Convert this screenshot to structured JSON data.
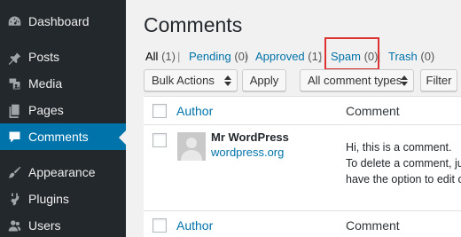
{
  "sidebar": {
    "items": [
      {
        "label": "Dashboard",
        "icon": "dashboard-icon"
      },
      {
        "label": "Posts",
        "icon": "pin-icon"
      },
      {
        "label": "Media",
        "icon": "media-icon"
      },
      {
        "label": "Pages",
        "icon": "pages-icon"
      },
      {
        "label": "Comments",
        "icon": "comment-bubble-icon",
        "current": true
      },
      {
        "label": "Appearance",
        "icon": "paintbrush-icon"
      },
      {
        "label": "Plugins",
        "icon": "plugin-icon"
      },
      {
        "label": "Users",
        "icon": "users-icon"
      }
    ]
  },
  "page_title": "Comments",
  "filters": [
    {
      "label": "All",
      "count": "(1)",
      "current": true
    },
    {
      "label": "Pending",
      "count": "(0)"
    },
    {
      "label": "Approved",
      "count": "(1)"
    },
    {
      "label": "Spam",
      "count": "(0)"
    },
    {
      "label": "Trash",
      "count": "(0)"
    }
  ],
  "toolbar": {
    "bulk_actions": "Bulk Actions",
    "apply": "Apply",
    "comment_types": "All comment types",
    "filter": "Filter"
  },
  "table": {
    "header": {
      "author": "Author",
      "comment": "Comment"
    },
    "rows": [
      {
        "author_name": "Mr WordPress",
        "author_url": "wordpress.org",
        "comment_lines": [
          "Hi, this is a comment.",
          "To delete a comment, ju",
          "have the option to edit o"
        ]
      }
    ],
    "footer": {
      "author": "Author",
      "comment": "Comment"
    }
  },
  "colors": {
    "sidebar_bg": "#23282d",
    "accent": "#0073aa",
    "highlight_box": "#dc3232"
  }
}
